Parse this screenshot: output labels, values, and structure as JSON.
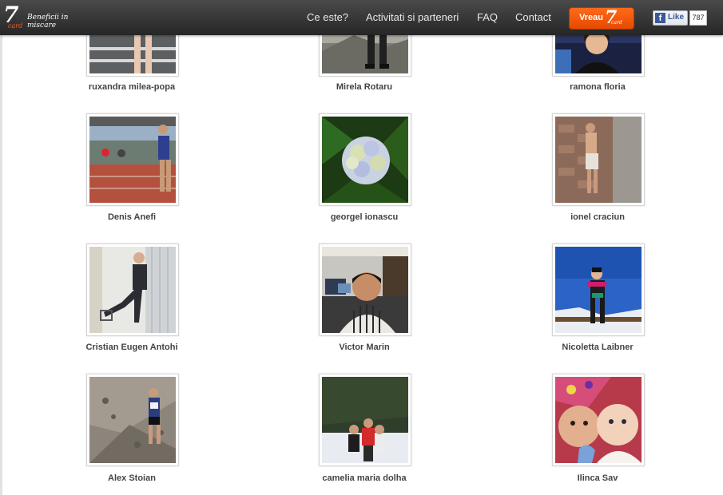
{
  "header": {
    "logo_tagline": "Beneficii in miscare",
    "logo_mark": "7",
    "logo_sub": "card",
    "nav": [
      {
        "label": "Ce este?"
      },
      {
        "label": "Activitati si parteneri"
      },
      {
        "label": "FAQ"
      },
      {
        "label": "Contact"
      }
    ],
    "cta_label": "Vreau",
    "cta_mark": "7",
    "cta_sub": "card",
    "fb_like_label": "Like",
    "fb_like_count": "787"
  },
  "members": [
    {
      "name": "ruxandra milea-popa"
    },
    {
      "name": "Mirela Rotaru"
    },
    {
      "name": "ramona floria"
    },
    {
      "name": "Denis Anefi"
    },
    {
      "name": "georgel ionascu"
    },
    {
      "name": "ionel craciun"
    },
    {
      "name": "Cristian Eugen Antohi"
    },
    {
      "name": "Victor Marin"
    },
    {
      "name": "Nicoletta Laibner"
    },
    {
      "name": "Alex Stoian"
    },
    {
      "name": "camelia maria dolha"
    },
    {
      "name": "Ilinca Sav"
    }
  ]
}
